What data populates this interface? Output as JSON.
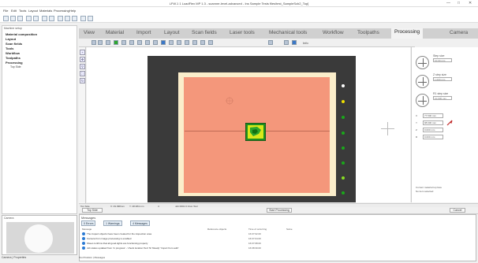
{
  "window": {
    "title": "LFW.1 1 LoadFlex MP 1.3 - scanner-level-advanced - Ins Sample Tests files\\test_SampleScb2_Top]",
    "controls": [
      "—",
      "□",
      "✕"
    ]
  },
  "menu": [
    "File",
    "Edit",
    "Tools",
    "Layout",
    "Materials",
    "Processing",
    "Help"
  ],
  "left_panel": {
    "header": "Machine setup",
    "tree": [
      "Material composition",
      "Layout",
      "Scan fields",
      "Tools",
      "Workflow",
      "Toolpaths",
      "Processing"
    ],
    "tree_sub": "Top Side"
  },
  "tabs": [
    "View",
    "Material",
    "Import",
    "Layout",
    "Scan fields",
    "Laser tools",
    "Mechanical tools",
    "Workflow",
    "Toolpaths",
    "Processing",
    "Camera"
  ],
  "active_tab": "Processing",
  "ribbon_extra": "Info",
  "viewport": {
    "dot_colors": [
      "#ffffff",
      "#f0e000",
      "#1aa81a",
      "#1aa81a",
      "#1aa81a",
      "#1aa81a",
      "#88dd22",
      "#1aa81a"
    ]
  },
  "jog": [
    {
      "label": "Step size",
      "value": "10.00 mm"
    },
    {
      "label": "Z step size",
      "value": "1.000 mm"
    },
    {
      "label": "R1 step size",
      "value": "10.000 mm"
    }
  ],
  "fields": [
    {
      "label": "X",
      "value": "77.500 mm"
    },
    {
      "label": "Y",
      "value": "98.600 mm"
    },
    {
      "label": "Z",
      "value": "0.000 mm"
    },
    {
      "label": "R",
      "value": "0.000 mm"
    }
  ],
  "right_footer": {
    "line1": "Current material top face",
    "line2": "No item selected"
  },
  "status": {
    "left_button": "Top Side",
    "coords_x": "X:  49.398mm",
    "coords_y": "Y:  48.384 mm",
    "zoom": "4",
    "file": "Job 0001 0 (Icon Top)",
    "center_button": "Start Processing",
    "right_button": "Cancel"
  },
  "messages": {
    "header": "Messages",
    "filters": [
      "0 Errors",
      "1 Warnings",
      "4 Messages"
    ],
    "columns": [
      "Message",
      "Reference objects",
      "Time of occurring",
      "Solve"
    ],
    "rows": [
      {
        "text": "The inspect objects have been created for the inspection area",
        "time": "16:07:02.00"
      },
      {
        "text": "Camera from image processing is enabled",
        "time": "16:07:04.00"
      },
      {
        "text": "Sheet confirms that all good-lights are functioning properly",
        "time": "16:07:08.00"
      },
      {
        "text": "Job status updated from 'in progress' - 'check location Test' N/ 'Ready' 'Import from auth'",
        "time": "16:08:30.00"
      }
    ],
    "bottom_tabs": "Tool Position  |  Messages"
  },
  "camera": {
    "header": "Camera",
    "bottom_tabs": "Camera  |  Properties"
  }
}
